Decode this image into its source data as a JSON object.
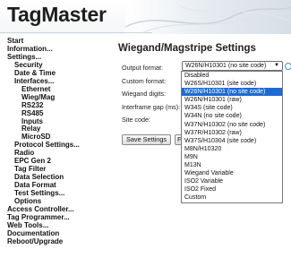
{
  "header": {
    "logo": "TagMaster"
  },
  "nav": {
    "items": [
      {
        "label": "Start",
        "level": 0
      },
      {
        "label": "Information...",
        "level": 0
      },
      {
        "label": "Settings...",
        "level": 0
      },
      {
        "label": "Security",
        "level": 1
      },
      {
        "label": "Date & Time",
        "level": 1
      },
      {
        "label": "Interfaces...",
        "level": 1
      },
      {
        "label": "Ethernet",
        "level": 2
      },
      {
        "label": "Wieg/Mag",
        "level": 2
      },
      {
        "label": "RS232",
        "level": 2
      },
      {
        "label": "RS485",
        "level": 2
      },
      {
        "label": "Inputs",
        "level": 2
      },
      {
        "label": "Relay",
        "level": 2
      },
      {
        "label": "MicroSD",
        "level": 2
      },
      {
        "label": "Protocol Settings...",
        "level": 1
      },
      {
        "label": "Radio",
        "level": 1
      },
      {
        "label": "EPC Gen 2",
        "level": 1
      },
      {
        "label": "Tag Filter",
        "level": 1
      },
      {
        "label": "Data Selection",
        "level": 1
      },
      {
        "label": "Data Format",
        "level": 1
      },
      {
        "label": "Test Settings...",
        "level": 1
      },
      {
        "label": "Options",
        "level": 1
      },
      {
        "label": "Access Controller...",
        "level": 0
      },
      {
        "label": "Tag Programmer...",
        "level": 0
      },
      {
        "label": "Web Tools...",
        "level": 0
      },
      {
        "label": "Documentation",
        "level": 0
      },
      {
        "label": "Reboot/Upgrade",
        "level": 0
      }
    ]
  },
  "main": {
    "title": "Wiegand/Magstripe Settings",
    "labels": {
      "output_format": "Output format:",
      "custom_format": "Custom format:",
      "wiegand_digits": "Wiegand digits:",
      "interframe_gap": "Interframe gap (ms):",
      "site_code": "Site code:"
    },
    "output_format_value": "W26N/H10301 (no site code)",
    "dropdown_arrow": "▼",
    "save_button": "Save Settings",
    "second_button": "F",
    "dropdown_options": [
      {
        "label": "Disabled",
        "selected": false
      },
      {
        "label": "W26S/H10301 (site code)",
        "selected": false
      },
      {
        "label": "W26N/H10301 (no site code)",
        "selected": true
      },
      {
        "label": "W26N/H10301 (raw)",
        "selected": false
      },
      {
        "label": "W34S (site code)",
        "selected": false
      },
      {
        "label": "W34N (no site code)",
        "selected": false
      },
      {
        "label": "W37N/H10302 (no site code)",
        "selected": false
      },
      {
        "label": "W37R/H10302 (raw)",
        "selected": false
      },
      {
        "label": "W37S/H10304 (site code)",
        "selected": false
      },
      {
        "label": "M8N/H10320",
        "selected": false
      },
      {
        "label": "M9N",
        "selected": false
      },
      {
        "label": "M13N",
        "selected": false
      },
      {
        "label": "Wiegand Variable",
        "selected": false
      },
      {
        "label": "ISO2 Variable",
        "selected": false
      },
      {
        "label": "ISO2 Fixed",
        "selected": false
      },
      {
        "label": "Custom",
        "selected": false
      }
    ]
  },
  "colors": {
    "selection": "#1e6ad3",
    "info_icon": "#4a8fd0"
  },
  "icons": {
    "info": "info-icon",
    "dropdown": "chevron-down-icon"
  }
}
